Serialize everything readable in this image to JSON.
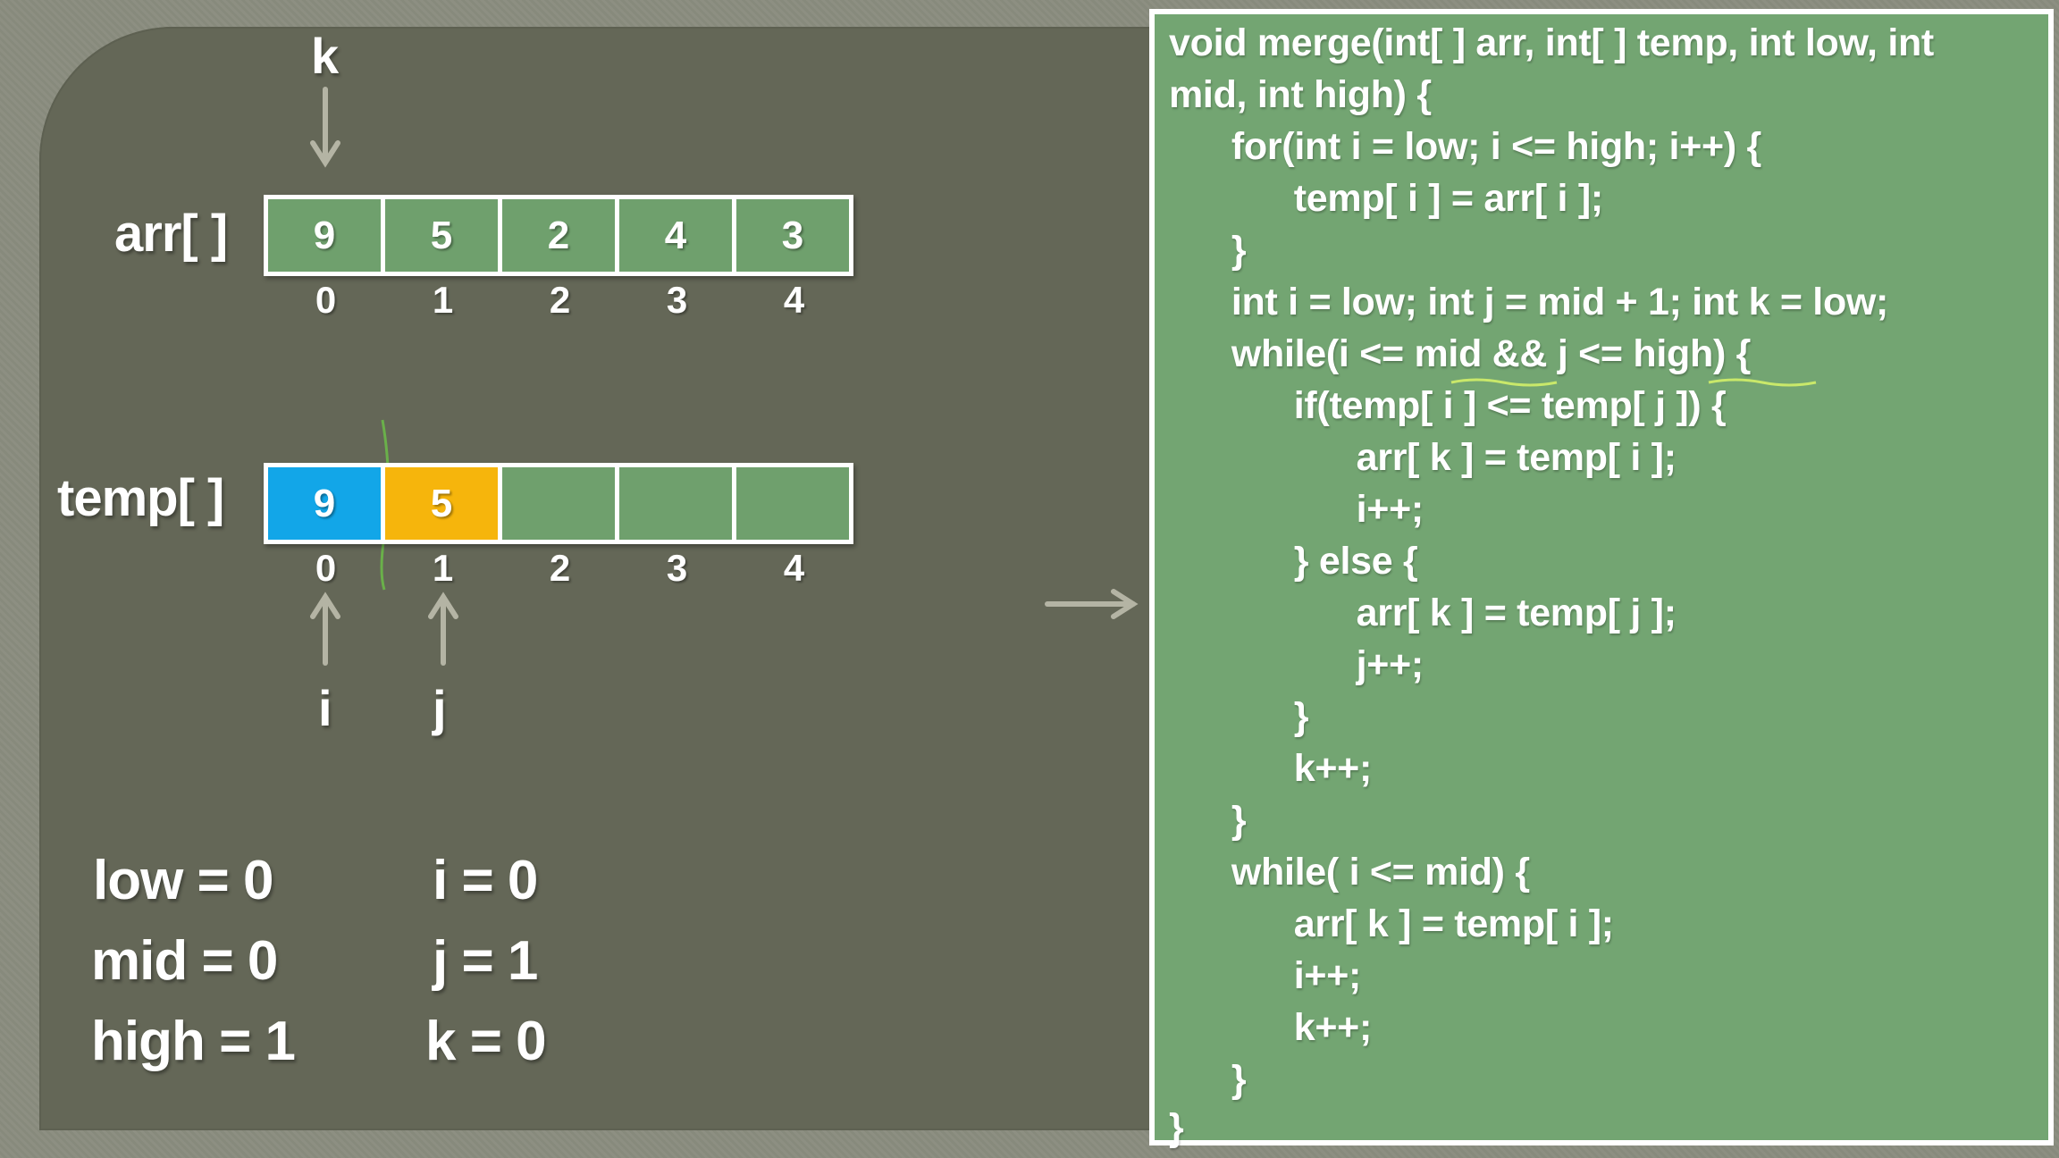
{
  "arr": {
    "label": "arr[ ]",
    "values": [
      "9",
      "5",
      "2",
      "4",
      "3"
    ],
    "indices": [
      "0",
      "1",
      "2",
      "3",
      "4"
    ]
  },
  "temp": {
    "label": "temp[ ]",
    "values": [
      "9",
      "5",
      "",
      "",
      ""
    ],
    "indices": [
      "0",
      "1",
      "2",
      "3",
      "4"
    ]
  },
  "pointers": {
    "k": "k",
    "i": "i",
    "j": "j"
  },
  "variables": {
    "low": "low = 0",
    "mid": "mid = 0",
    "high": "high = 1",
    "i": "i = 0",
    "j": "j = 1",
    "k": "k = 0"
  },
  "colors": {
    "cell_green": "#6fa06d",
    "cell_blue": "#12a6e8",
    "cell_orange": "#f6b50c",
    "code_bg": "#73a572",
    "slide_bg": "#646757"
  },
  "code": [
    "void merge(int[ ] arr, int[ ] temp, int low, int",
    "mid, int high) {",
    "      for(int i = low; i <= high; i++) {",
    "            temp[ i ] = arr[ i ];",
    "      }",
    "      int i = low; int j = mid + 1; int k = low;",
    "      while(i <= mid && j <= high) {",
    "            if(temp[ i ] <= temp[ j ]) {",
    "                  arr[ k ] = temp[ i ];",
    "                  i++;",
    "            } else {",
    "                  arr[ k ] = temp[ j ];",
    "                  j++;",
    "            }",
    "            k++;",
    "      }",
    "      while( i <= mid) {",
    "            arr[ k ] = temp[ i ];",
    "            i++;",
    "            k++;",
    "      }",
    "}"
  ]
}
